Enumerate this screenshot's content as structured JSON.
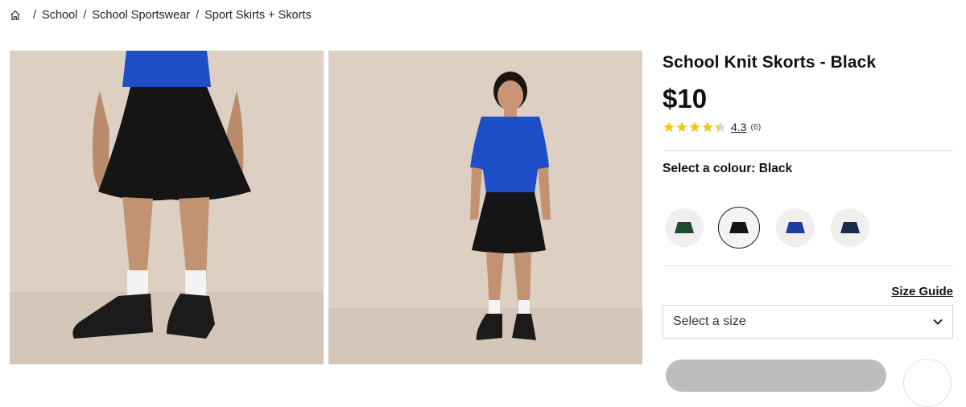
{
  "breadcrumb": {
    "home_icon": "home-icon",
    "items": [
      "School",
      "School Sportswear",
      "Sport Skirts + Skorts"
    ],
    "separator": "/"
  },
  "product": {
    "title": "School Knit Skorts - Black",
    "price": "$10",
    "rating": {
      "value": "4.3",
      "count": "(6)",
      "stars": 4.3
    },
    "colour_label": "Select a colour: Black",
    "colours": [
      {
        "name": "green",
        "hex": "#1f4a2c"
      },
      {
        "name": "black",
        "hex": "#151515",
        "selected": true
      },
      {
        "name": "royal-blue",
        "hex": "#1d3f9e"
      },
      {
        "name": "navy",
        "hex": "#1b2a4a"
      }
    ],
    "size_guide": "Size Guide",
    "size_placeholder": "Select a size"
  },
  "colors": {
    "accent_star": "#f5c518",
    "photo_bg": "#ddd0c2",
    "shirt_blue": "#1e4fc8"
  }
}
